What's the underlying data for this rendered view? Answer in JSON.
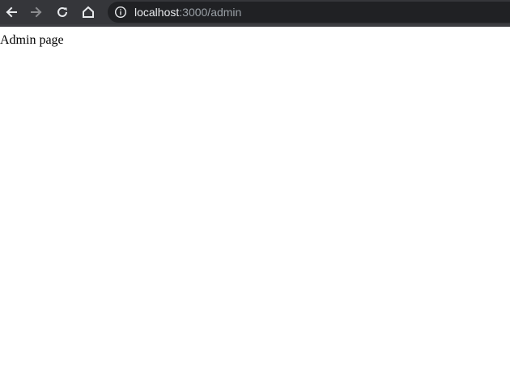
{
  "browser": {
    "toolbar_color": "#35363a",
    "omnibox_color": "#202124",
    "icons": {
      "back": "back-arrow-icon",
      "forward": "forward-arrow-icon",
      "reload": "reload-icon",
      "home": "home-icon",
      "site_info": "info-icon"
    },
    "address": {
      "host": "localhost",
      "rest": ":3000/admin"
    }
  },
  "page": {
    "text": "Admin page"
  }
}
